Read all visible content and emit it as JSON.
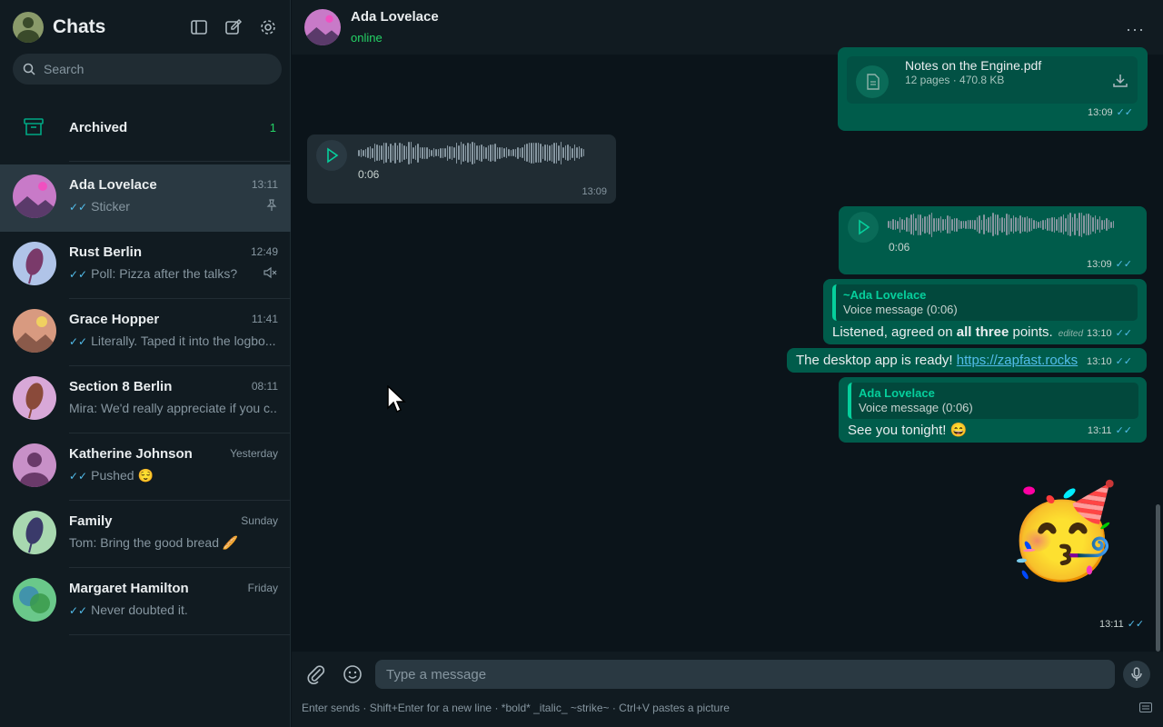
{
  "sidebar": {
    "title": "Chats",
    "search_placeholder": "Search",
    "archived": {
      "label": "Archived",
      "count": "1"
    },
    "chats": [
      {
        "name": "Ada Lovelace",
        "time": "13:11",
        "preview": "Sticker",
        "ticks": true,
        "badge_icon": "pin-icon",
        "active": true
      },
      {
        "name": "Rust Berlin",
        "time": "12:49",
        "preview": "Poll: Pizza after the talks?",
        "ticks": true,
        "badge_icon": "mute-icon"
      },
      {
        "name": "Grace Hopper",
        "time": "11:41",
        "preview": "Literally. Taped it into the logbo...",
        "ticks": true
      },
      {
        "name": "Section 8 Berlin",
        "time": "08:11",
        "preview": "Mira: We'd really appreciate if you c...",
        "ticks": false
      },
      {
        "name": "Katherine Johnson",
        "time": "Yesterday",
        "preview": "Pushed 😌",
        "ticks": true
      },
      {
        "name": "Family",
        "time": "Sunday",
        "preview": "Tom: Bring the good bread 🥖",
        "ticks": false
      },
      {
        "name": "Margaret Hamilton",
        "time": "Friday",
        "preview": "Never doubted it.",
        "ticks": true
      }
    ]
  },
  "header": {
    "contact_name": "Ada Lovelace",
    "status": "online",
    "more_label": "···"
  },
  "messages": {
    "doc": {
      "file_name": "Notes on the Engine.pdf",
      "meta": "12 pages · 470.8 KB",
      "time": "13:09"
    },
    "voice_in": {
      "duration": "0:06",
      "time": "13:09"
    },
    "voice_out": {
      "duration": "0:06",
      "time": "13:09"
    },
    "reply1": {
      "quote_author": "~Ada Lovelace",
      "quote_text": "Voice message (0:06)",
      "text_before": "Listened, agreed on ",
      "text_bold": "all three",
      "text_after": " points.",
      "edited": "edited",
      "time": "13:10"
    },
    "link_msg": {
      "text": "The desktop app is ready! ",
      "link": "https://zapfast.rocks",
      "time": "13:10"
    },
    "reply2": {
      "quote_author": "Ada Lovelace",
      "quote_text": "Voice message (0:06)",
      "text": "See you tonight! 😄",
      "time": "13:11"
    },
    "sticker": {
      "emoji": "🥳",
      "time": "13:11"
    }
  },
  "composer": {
    "placeholder": "Type a message",
    "hint": "Enter sends · Shift+Enter for a new line · *bold* _italic_ ~strike~ · Ctrl+V pastes a picture"
  },
  "colors": {
    "accent": "#25d366",
    "outgoing_bubble": "#005c4b",
    "incoming_bubble": "#202c33",
    "tick_blue": "#53bdeb"
  }
}
